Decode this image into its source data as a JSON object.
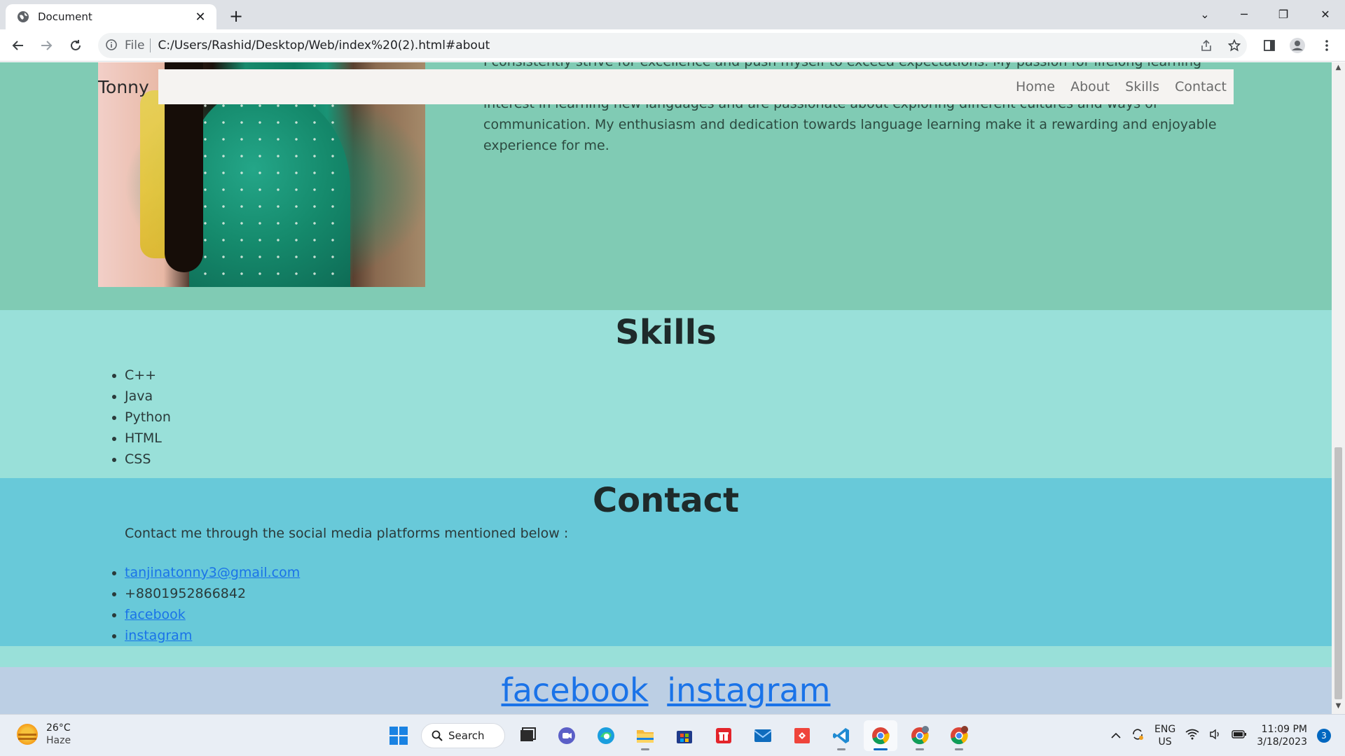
{
  "browser": {
    "tab_title": "Document",
    "file_label": "File",
    "url": "C:/Users/Rashid/Desktop/Web/index%20(2).html#about"
  },
  "page": {
    "brand": "Tonny",
    "nav": [
      "Home",
      "About",
      "Skills",
      "Contact"
    ],
    "about_text": "I consistently strive for excellence and push myself to exceed expectations. My passion for lifelong learning fuels my inclusivity, and actively seek to create a welcoming and supportive environment for all. I have a keen interest in learning new languages and are passionate about exploring different cultures and ways of communication. My enthusiasm and dedication towards language learning make it a rewarding and enjoyable experience for me.",
    "skills_title": "Skills",
    "skills": [
      "C++",
      "Java",
      "Python",
      "HTML",
      "CSS"
    ],
    "contact_title": "Contact",
    "contact_intro": "Contact me through the social media platforms mentioned below :",
    "contact_items": {
      "email": "tanjinatonny3@gmail.com",
      "phone": "+8801952866842",
      "facebook": "facebook",
      "instagram": "instagram"
    },
    "footer_links": [
      "facebook",
      "instagram"
    ]
  },
  "taskbar": {
    "weather_temp": "26°C",
    "weather_desc": "Haze",
    "search_label": "Search",
    "lang_top": "ENG",
    "lang_bottom": "US",
    "time": "11:09 PM",
    "date": "3/18/2023",
    "notification_count": "3"
  },
  "colors": {
    "about_bg": "#80cbb4",
    "skills_bg": "#99e0d9",
    "contact_bg": "#68c9d9",
    "footer_bg": "#bccfe4",
    "link": "#1a73e8"
  }
}
